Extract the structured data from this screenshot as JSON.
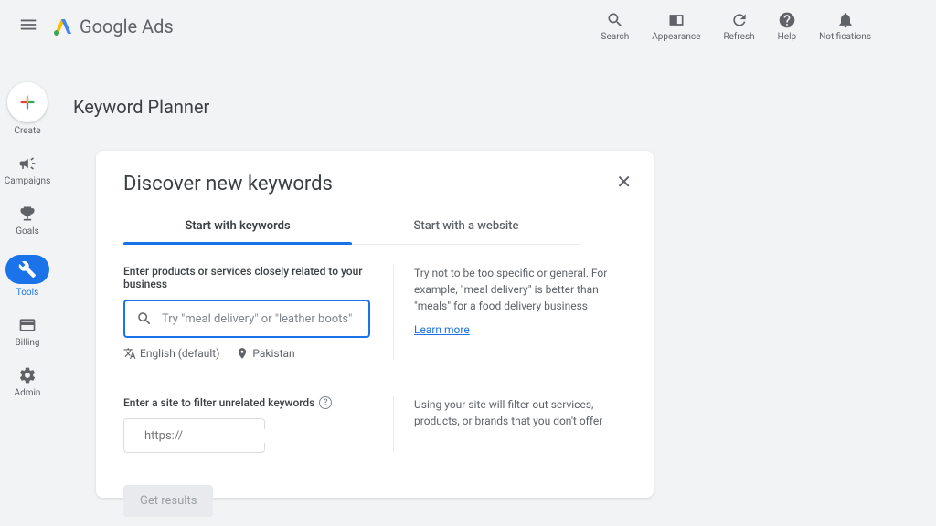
{
  "brand": "Google Ads",
  "topActions": {
    "search": "Search",
    "appearance": "Appearance",
    "refresh": "Refresh",
    "help": "Help",
    "notifications": "Notifications"
  },
  "rail": {
    "create": "Create",
    "campaigns": "Campaigns",
    "goals": "Goals",
    "tools": "Tools",
    "billing": "Billing",
    "admin": "Admin"
  },
  "pageTitle": "Keyword Planner",
  "card": {
    "title": "Discover new keywords",
    "tabKeywords": "Start with keywords",
    "tabWebsite": "Start with a website",
    "field1Label": "Enter products or services closely related to your business",
    "field1Placeholder": "Try \"meal delivery\" or \"leather boots\"",
    "languageChip": "English (default)",
    "locationChip": "Pakistan",
    "tip1": "Try not to be too specific or general. For example, \"meal delivery\" is better than \"meals\" for a food delivery business",
    "learnMore": "Learn more",
    "field2Label": "Enter a site to filter unrelated keywords",
    "field2Placeholder": "https://",
    "tip2": "Using your site will filter out services, products, or brands that you don't offer",
    "getResults": "Get results"
  }
}
